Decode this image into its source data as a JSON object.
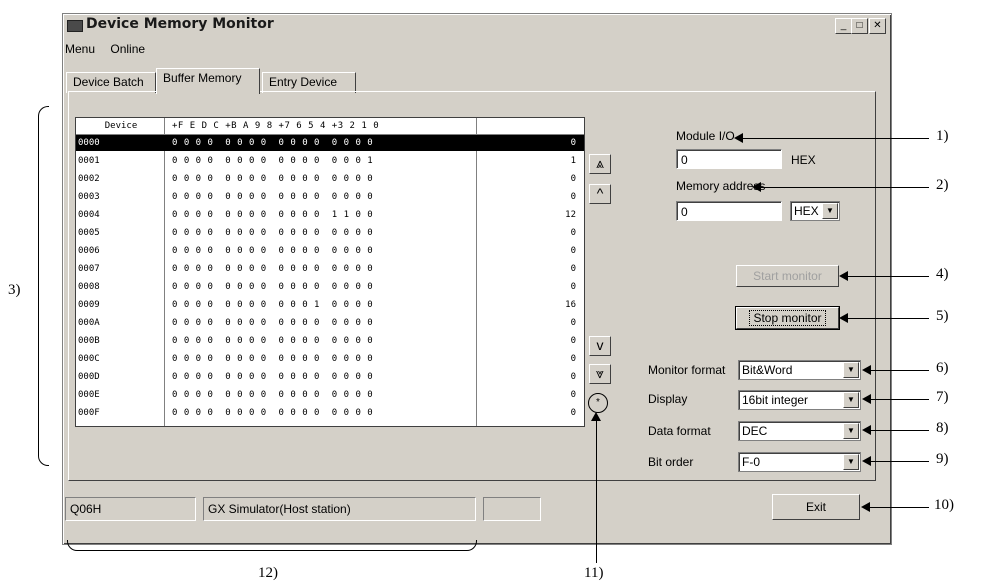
{
  "window": {
    "title": "Device Memory Monitor"
  },
  "menu": [
    "Menu",
    "Online"
  ],
  "tabs": [
    "Device Batch",
    "Buffer Memory",
    "Entry Device"
  ],
  "grid": {
    "headers": [
      "Device",
      "+F E D C +B A 9 8 +7 6 5 4 +3 2 1 0",
      ""
    ],
    "rows": [
      {
        "dev": "0000",
        "bits": "0 0 0 0  0 0 0 0  0 0 0 0  0 0 0 0",
        "val": "0"
      },
      {
        "dev": "0001",
        "bits": "0 0 0 0  0 0 0 0  0 0 0 0  0 0 0 1",
        "val": "1"
      },
      {
        "dev": "0002",
        "bits": "0 0 0 0  0 0 0 0  0 0 0 0  0 0 0 0",
        "val": "0"
      },
      {
        "dev": "0003",
        "bits": "0 0 0 0  0 0 0 0  0 0 0 0  0 0 0 0",
        "val": "0"
      },
      {
        "dev": "0004",
        "bits": "0 0 0 0  0 0 0 0  0 0 0 0  1 1 0 0",
        "val": "12"
      },
      {
        "dev": "0005",
        "bits": "0 0 0 0  0 0 0 0  0 0 0 0  0 0 0 0",
        "val": "0"
      },
      {
        "dev": "0006",
        "bits": "0 0 0 0  0 0 0 0  0 0 0 0  0 0 0 0",
        "val": "0"
      },
      {
        "dev": "0007",
        "bits": "0 0 0 0  0 0 0 0  0 0 0 0  0 0 0 0",
        "val": "0"
      },
      {
        "dev": "0008",
        "bits": "0 0 0 0  0 0 0 0  0 0 0 0  0 0 0 0",
        "val": "0"
      },
      {
        "dev": "0009",
        "bits": "0 0 0 0  0 0 0 0  0 0 0 1  0 0 0 0",
        "val": "16"
      },
      {
        "dev": "000A",
        "bits": "0 0 0 0  0 0 0 0  0 0 0 0  0 0 0 0",
        "val": "0"
      },
      {
        "dev": "000B",
        "bits": "0 0 0 0  0 0 0 0  0 0 0 0  0 0 0 0",
        "val": "0"
      },
      {
        "dev": "000C",
        "bits": "0 0 0 0  0 0 0 0  0 0 0 0  0 0 0 0",
        "val": "0"
      },
      {
        "dev": "000D",
        "bits": "0 0 0 0  0 0 0 0  0 0 0 0  0 0 0 0",
        "val": "0"
      },
      {
        "dev": "000E",
        "bits": "0 0 0 0  0 0 0 0  0 0 0 0  0 0 0 0",
        "val": "0"
      },
      {
        "dev": "000F",
        "bits": "0 0 0 0  0 0 0 0  0 0 0 0  0 0 0 0",
        "val": "0"
      }
    ]
  },
  "scroll": {
    "page_up": "⩓",
    "up": "^",
    "down": "v",
    "page_down": "⩔",
    "asterisk": "*"
  },
  "form": {
    "module_io_label": "Module I/O",
    "module_io_value": "0",
    "module_io_unit": "HEX",
    "memory_address_label": "Memory address",
    "memory_address_value": "0",
    "memory_address_unit": "HEX",
    "start_monitor": "Start monitor",
    "stop_monitor": "Stop monitor",
    "monitor_format_label": "Monitor format",
    "monitor_format_value": "Bit&Word",
    "display_label": "Display",
    "display_value": "16bit integer",
    "data_format_label": "Data format",
    "data_format_value": "DEC",
    "bit_order_label": "Bit order",
    "bit_order_value": "F-0"
  },
  "status": {
    "cpu": "Q06H",
    "connection": "GX Simulator(Host station)",
    "extra": ""
  },
  "exit_label": "Exit",
  "callouts": [
    "1)",
    "2)",
    "3)",
    "4)",
    "5)",
    "6)",
    "7)",
    "8)",
    "9)",
    "10)",
    "11)",
    "12)"
  ]
}
